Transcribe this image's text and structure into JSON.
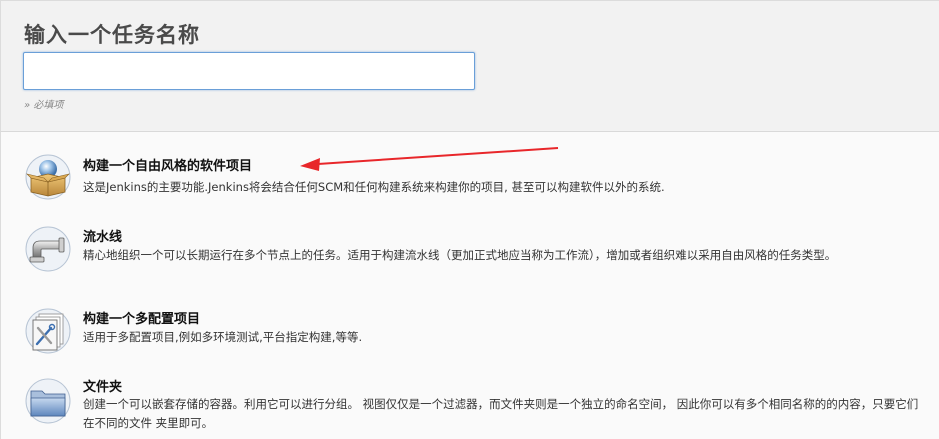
{
  "name_section": {
    "title": "输入一个任务名称",
    "input_value": "",
    "input_placeholder": "",
    "required_hint": "» 必填项"
  },
  "job_types": [
    {
      "label": "构建一个自由风格的软件项目",
      "description": "这是Jenkins的主要功能.Jenkins将会结合任何SCM和任何构建系统来构建你的项目, 甚至可以构建软件以外的系统.",
      "icon": "freestyle-project-icon"
    },
    {
      "label": "流水线",
      "description": "精心地组织一个可以长期运行在多个节点上的任务。适用于构建流水线（更加正式地应当称为工作流），增加或者组织难以采用自由风格的任务类型。",
      "icon": "pipeline-icon"
    },
    {
      "label": "构建一个多配置项目",
      "description": "适用于多配置项目,例如多环境测试,平台指定构建,等等.",
      "icon": "multi-configuration-icon"
    },
    {
      "label": "文件夹",
      "description": "创建一个可以嵌套存储的容器。利用它可以进行分组。 视图仅仅是一个过滤器，而文件夹则是一个独立的命名空间， 因此你可以有多个相同名称的的内容，只要它们在不同的文件 夹里即可。",
      "icon": "folder-icon"
    }
  ],
  "colors": {
    "annotation_arrow": "#e8262a",
    "input_border": "#6a9fd8",
    "header_bg": "#f2f2f2"
  }
}
